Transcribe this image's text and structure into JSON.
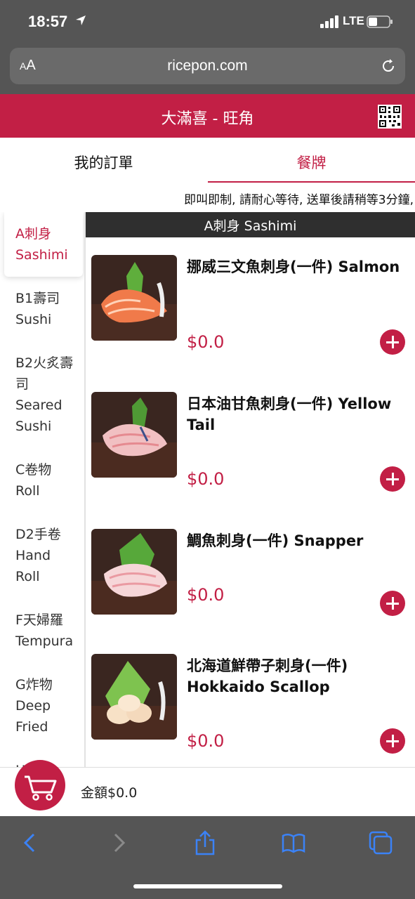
{
  "status": {
    "time": "18:57",
    "network": "LTE",
    "icons": [
      "location-arrow-icon",
      "signal-bars-icon",
      "battery-icon"
    ]
  },
  "browser": {
    "text_size_label_small": "A",
    "text_size_label_large": "A",
    "url": "ricepon.com",
    "icons": [
      "reload-icon",
      "back-icon",
      "forward-icon",
      "share-icon",
      "bookmarks-icon",
      "tabs-icon"
    ]
  },
  "header": {
    "title": "大滿喜 - 旺角",
    "qr_icon": "qr-code-icon"
  },
  "tabs": [
    {
      "label": "我的訂單"
    },
    {
      "label": "餐牌"
    }
  ],
  "notice": "即叫即制, 請耐心等待, 送單後請稍等3分鐘,",
  "sidebar": {
    "categories": [
      {
        "line1": "A刺身",
        "line2": "Sashimi"
      },
      {
        "line1": "B1壽司",
        "line2": "Sushi"
      },
      {
        "line1": "B2火炙壽",
        "line2": "司",
        "line3": "Seared",
        "line4": "Sushi"
      },
      {
        "line1": "C卷物",
        "line2": "Roll"
      },
      {
        "line1": "D2手卷",
        "line2": "Hand",
        "line3": "Roll"
      },
      {
        "line1": "F天婦羅",
        "line2": "Tempura"
      },
      {
        "line1": "G炸物",
        "line2": "Deep",
        "line3": "Fried"
      },
      {
        "line1": "H燒物"
      }
    ]
  },
  "section": {
    "title": "A刺身 Sashimi"
  },
  "items": [
    {
      "name": "挪威三文魚刺身(一件) Salmon",
      "price": "$0.0"
    },
    {
      "name": "日本油甘魚刺身(一件) Yellow Tail",
      "price": "$0.0"
    },
    {
      "name": "鯛魚刺身(一件) Snapper",
      "price": "$0.0"
    },
    {
      "name": "北海道鮮帶子刺身(一件) Hokkaido Scallop",
      "price": "$0.0"
    }
  ],
  "cart": {
    "icon": "cart-icon",
    "total_label": "金額$0.0"
  },
  "colors": {
    "brand": "#c21f45",
    "chrome": "#555555"
  }
}
